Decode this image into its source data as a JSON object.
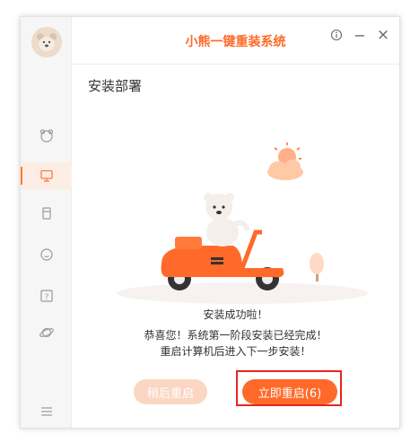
{
  "window": {
    "title": "小熊一键重装系统",
    "section_title": "安装部署"
  },
  "window_controls": {
    "info_icon": "info-icon",
    "minimize_label": "−",
    "close_label": "×"
  },
  "sidebar": {
    "items": [
      {
        "icon": "bear-face-icon"
      },
      {
        "icon": "monitor-icon",
        "active": true
      },
      {
        "icon": "usb-drive-icon"
      },
      {
        "icon": "chat-bubble-icon"
      },
      {
        "icon": "help-question-icon"
      },
      {
        "icon": "planet-icon"
      },
      {
        "icon": "menu-icon"
      }
    ]
  },
  "message": {
    "heading": "安装成功啦！",
    "line1": "恭喜您！系统第一阶段安装已经完成！",
    "line2": "重启计算机后进入下一步安装！"
  },
  "buttons": {
    "later_label": "稍后重启",
    "now_label": "立即重启(6)"
  },
  "colors": {
    "accent": "#ff6a2a",
    "accent_light": "#fbd6c2",
    "highlight_border": "#e8231e"
  }
}
